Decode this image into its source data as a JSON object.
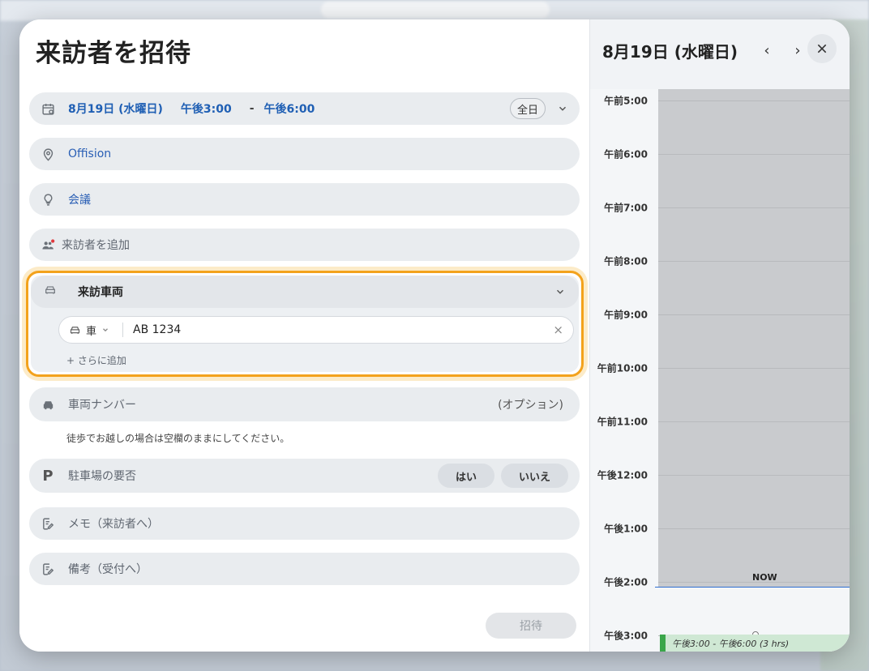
{
  "dialog": {
    "title": "来訪者を招待",
    "date_row": {
      "date": "8月19日 (水曜日)",
      "start": "午後3:00",
      "dash": "-",
      "end": "午後6:00",
      "allday_label": "全日"
    },
    "location": "Offision",
    "purpose": "会議",
    "add_visitor": "来訪者を追加",
    "vehicle": {
      "header": "来訪車両",
      "type_label": "車",
      "plate_value": "AB 1234",
      "clear_icon": "×",
      "add_more": "+ さらに追加"
    },
    "plate_number": {
      "label": "車両ナンバー",
      "optional": "(オプション)"
    },
    "walk_hint": "徒歩でお越しの場合は空欄のままにしてください。",
    "parking": {
      "label": "駐車場の要否",
      "yes": "はい",
      "no": "いいえ",
      "icon_letter": "P"
    },
    "memo_placeholder": "メモ（来訪者へ）",
    "notes_placeholder": "備考（受付へ）",
    "invite_button": "招待"
  },
  "calendar": {
    "date": "8月19日 (水曜日)",
    "prev": "‹",
    "next": "›",
    "hours": [
      "午前5:00",
      "午前6:00",
      "午前7:00",
      "午前8:00",
      "午前9:00",
      "午前10:00",
      "午前11:00",
      "午後12:00",
      "午後1:00",
      "午後2:00",
      "午後3:00"
    ],
    "now_label": "NOW",
    "event_label": "午後3:00 - 午後6:00 (3 hrs)",
    "event_color": "#3aa64a"
  },
  "colors": {
    "accent_blue": "#1f5fb4",
    "highlight_orange": "#f3a21c"
  }
}
